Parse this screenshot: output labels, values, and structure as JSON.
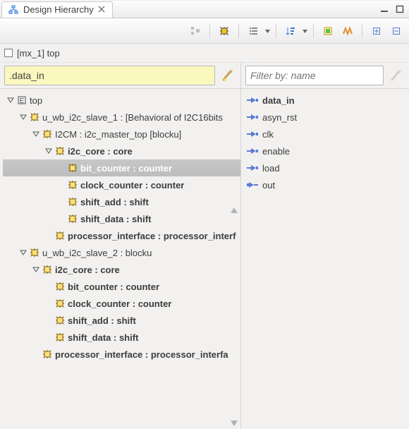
{
  "title": "Design Hierarchy",
  "breadcrumb": {
    "text": "[mx_1] top"
  },
  "filter_value": ".data_in",
  "right_filter_placeholder": "Filter by: name",
  "tree": [
    {
      "indent": 0,
      "twisty": "open",
      "icon": "box",
      "label": "top",
      "bold": false
    },
    {
      "indent": 1,
      "twisty": "open",
      "icon": "chip",
      "label": "u_wb_i2c_slave_1 : [Behavioral of I2C16bits",
      "bold": false
    },
    {
      "indent": 2,
      "twisty": "open",
      "icon": "chip",
      "label": "I2CM : i2c_master_top [blocku]",
      "bold": false
    },
    {
      "indent": 3,
      "twisty": "open",
      "icon": "chip",
      "label": "i2c_core : core",
      "bold": true
    },
    {
      "indent": 4,
      "twisty": "none",
      "icon": "chip",
      "label": "bit_counter : counter",
      "bold": true,
      "selected": true
    },
    {
      "indent": 4,
      "twisty": "none",
      "icon": "chip",
      "label": "clock_counter : counter",
      "bold": true
    },
    {
      "indent": 4,
      "twisty": "none",
      "icon": "chip",
      "label": "shift_add : shift",
      "bold": true
    },
    {
      "indent": 4,
      "twisty": "none",
      "icon": "chip",
      "label": "shift_data : shift",
      "bold": true
    },
    {
      "indent": 3,
      "twisty": "none",
      "icon": "chip",
      "label": "processor_interface : processor_interf",
      "bold": true
    },
    {
      "indent": 1,
      "twisty": "open",
      "icon": "chip",
      "label": "u_wb_i2c_slave_2 : blocku",
      "bold": false
    },
    {
      "indent": 2,
      "twisty": "open",
      "icon": "chip",
      "label": "i2c_core : core",
      "bold": true
    },
    {
      "indent": 3,
      "twisty": "none",
      "icon": "chip",
      "label": "bit_counter : counter",
      "bold": true
    },
    {
      "indent": 3,
      "twisty": "none",
      "icon": "chip",
      "label": "clock_counter : counter",
      "bold": true
    },
    {
      "indent": 3,
      "twisty": "none",
      "icon": "chip",
      "label": "shift_add : shift",
      "bold": true
    },
    {
      "indent": 3,
      "twisty": "none",
      "icon": "chip",
      "label": "shift_data : shift",
      "bold": true
    },
    {
      "indent": 2,
      "twisty": "none",
      "icon": "chip",
      "label": "processor_interface : processor_interfa",
      "bold": true
    }
  ],
  "signals": [
    {
      "label": "data_in",
      "dir": "in",
      "bold": true
    },
    {
      "label": "asyn_rst",
      "dir": "in",
      "bold": false
    },
    {
      "label": "clk",
      "dir": "in",
      "bold": false
    },
    {
      "label": "enable",
      "dir": "in",
      "bold": false
    },
    {
      "label": "load",
      "dir": "in",
      "bold": false
    },
    {
      "label": "out",
      "dir": "out",
      "bold": false
    }
  ]
}
